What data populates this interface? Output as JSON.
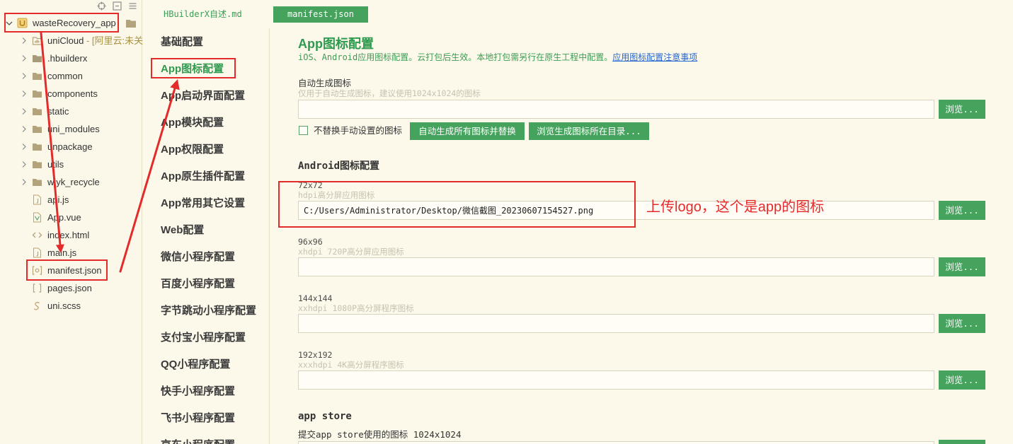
{
  "colors": {
    "background": "#fdf9ea",
    "accent": "#46a35e",
    "title_green": "#2f9a4f",
    "desc_green": "#3b9d55",
    "tab_green": "#3a9f58",
    "link": "#2667d0",
    "annotation": "#e42b2b"
  },
  "sidebar": {
    "toolbar": {
      "icons": [
        "target-icon",
        "collapse-all-icon",
        "menu-icon"
      ]
    },
    "root": {
      "label": "wasteRecovery_app",
      "icon": "project-icon",
      "expanded": true
    },
    "items": [
      {
        "label": "uniCloud",
        "note": "- [阿里云:未关",
        "icon": "cloud-folder-icon"
      },
      {
        "label": ".hbuilderx",
        "icon": "folder-icon"
      },
      {
        "label": "common",
        "icon": "folder-icon"
      },
      {
        "label": "components",
        "icon": "folder-icon"
      },
      {
        "label": "static",
        "icon": "folder-icon"
      },
      {
        "label": "uni_modules",
        "icon": "folder-icon"
      },
      {
        "label": "unpackage",
        "icon": "folder-icon"
      },
      {
        "label": "utils",
        "icon": "folder-icon"
      },
      {
        "label": "wjyk_recycle",
        "icon": "folder-icon"
      },
      {
        "label": "api.js",
        "icon": "js-file-icon"
      },
      {
        "label": "App.vue",
        "icon": "vue-file-icon"
      },
      {
        "label": "index.html",
        "icon": "html-file-icon"
      },
      {
        "label": "main.js",
        "icon": "js-file-icon"
      },
      {
        "label": "manifest.json",
        "icon": "manifest-file-icon",
        "selected": true
      },
      {
        "label": "pages.json",
        "icon": "json-file-icon"
      },
      {
        "label": "uni.scss",
        "icon": "scss-file-icon"
      }
    ]
  },
  "tabs": [
    {
      "label": "HBuilderX自述.md",
      "active": false
    },
    {
      "label": "manifest.json",
      "active": true
    }
  ],
  "nav": {
    "items": [
      {
        "label": "基础配置",
        "active": false
      },
      {
        "label": "App图标配置",
        "active": true
      },
      {
        "label": "App启动界面配置",
        "active": false
      },
      {
        "label": "App模块配置",
        "active": false
      },
      {
        "label": "App权限配置",
        "active": false
      },
      {
        "label": "App原生插件配置",
        "active": false
      },
      {
        "label": "App常用其它设置",
        "active": false
      },
      {
        "label": "Web配置",
        "active": false
      },
      {
        "label": "微信小程序配置",
        "active": false
      },
      {
        "label": "百度小程序配置",
        "active": false
      },
      {
        "label": "字节跳动小程序配置",
        "active": false
      },
      {
        "label": "支付宝小程序配置",
        "active": false
      },
      {
        "label": "QQ小程序配置",
        "active": false
      },
      {
        "label": "快手小程序配置",
        "active": false
      },
      {
        "label": "飞书小程序配置",
        "active": false
      },
      {
        "label": "京东小程序配置",
        "active": false
      }
    ]
  },
  "main": {
    "title": "App图标配置",
    "description": "iOS、Android应用图标配置。云打包后生效。本地打包需另行在原生工程中配置。",
    "description_link": "应用图标配置注意事项",
    "auto_generate": {
      "label": "自动生成图标",
      "hint": "仅用于自动生成图标，建议使用1024x1024的图标",
      "value": "",
      "browse": "浏览...",
      "keep_manual_checkbox": {
        "label": "不替换手动设置的图标",
        "checked": false
      },
      "generate_button": "自动生成所有图标并替换",
      "open_dir_button": "浏览生成图标所在目录..."
    },
    "android": {
      "title": "Android图标配置",
      "icons": [
        {
          "size": "72x72",
          "hint": "hdpi高分屏应用图标",
          "value": "C:/Users/Administrator/Desktop/微信截图_20230607154527.png",
          "browse": "浏览..."
        },
        {
          "size": "96x96",
          "hint": "xhdpi 720P高分屏应用图标",
          "value": "",
          "browse": "浏览..."
        },
        {
          "size": "144x144",
          "hint": "xxhdpi 1080P高分屏程序图标",
          "value": "",
          "browse": "浏览..."
        },
        {
          "size": "192x192",
          "hint": "xxxhdpi 4K高分屏程序图标",
          "value": "",
          "browse": "浏览..."
        }
      ]
    },
    "app_store": {
      "title": "app store",
      "label": "提交app store使用的图标 1024x1024",
      "value": ""
    }
  },
  "annotation": {
    "text": "上传logo，这个是app的图标"
  }
}
